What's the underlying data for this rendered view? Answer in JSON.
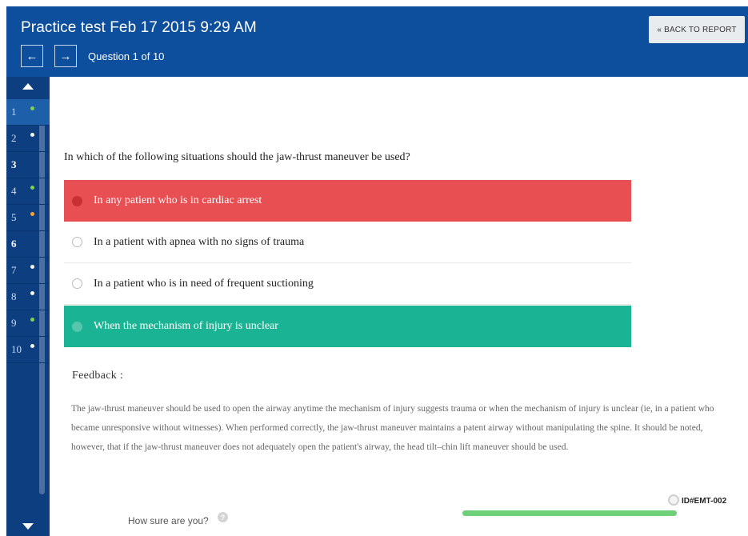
{
  "header": {
    "title": "Practice test Feb 17 2015 9:29 AM",
    "prev_glyph": "←",
    "next_glyph": "→",
    "question_count": "Question 1 of 10",
    "back_label": "« BACK TO REPORT"
  },
  "sidebar": {
    "items": [
      {
        "label": "1",
        "dot": "#7bd35a",
        "active": true
      },
      {
        "label": "2",
        "dot": "#f5f5f5",
        "active": false
      },
      {
        "label": "3",
        "dot": "",
        "active": false
      },
      {
        "label": "4",
        "dot": "#7bd35a",
        "active": false
      },
      {
        "label": "5",
        "dot": "#f2a43a",
        "active": false
      },
      {
        "label": "6",
        "dot": "",
        "active": false
      },
      {
        "label": "7",
        "dot": "#f5f5f5",
        "active": false
      },
      {
        "label": "8",
        "dot": "#f5f5f5",
        "active": false
      },
      {
        "label": "9",
        "dot": "#7bd35a",
        "active": false
      },
      {
        "label": "10",
        "dot": "#f5f5f5",
        "active": false
      }
    ]
  },
  "question": {
    "text": "In which of the following situations should the jaw-thrust maneuver be used?",
    "options": [
      {
        "text": "In any patient who is in cardiac arrest",
        "state": "wrong"
      },
      {
        "text": "In a patient with apnea with no signs of trauma",
        "state": "plain"
      },
      {
        "text": "In a patient who is in need of frequent suctioning",
        "state": "plain"
      },
      {
        "text": "When the mechanism of injury is unclear",
        "state": "right"
      }
    ]
  },
  "feedback": {
    "title": "Feedback :",
    "text": "The jaw-thrust maneuver should be used to open the airway anytime the mechanism of injury suggests trauma or when the mechanism of injury is unclear (ie, in a patient who became unresponsive without witnesses). When performed correctly, the jaw-thrust maneuver maintains a patent airway without manipulating the spine. It should be noted, however, that if the jaw-thrust maneuver does not adequately open the patient's airway, the head tilt–chin lift maneuver should be used."
  },
  "confidence": {
    "label": "How sure are you?",
    "help_glyph": "?",
    "level": 1.0,
    "question_id": "ID#EMT-002"
  },
  "colors": {
    "header": "#0d4f9c",
    "sidebar": "#0d3f80",
    "wrong": "#e74f53",
    "right": "#1ab394",
    "confidence": "#6fd07a"
  }
}
